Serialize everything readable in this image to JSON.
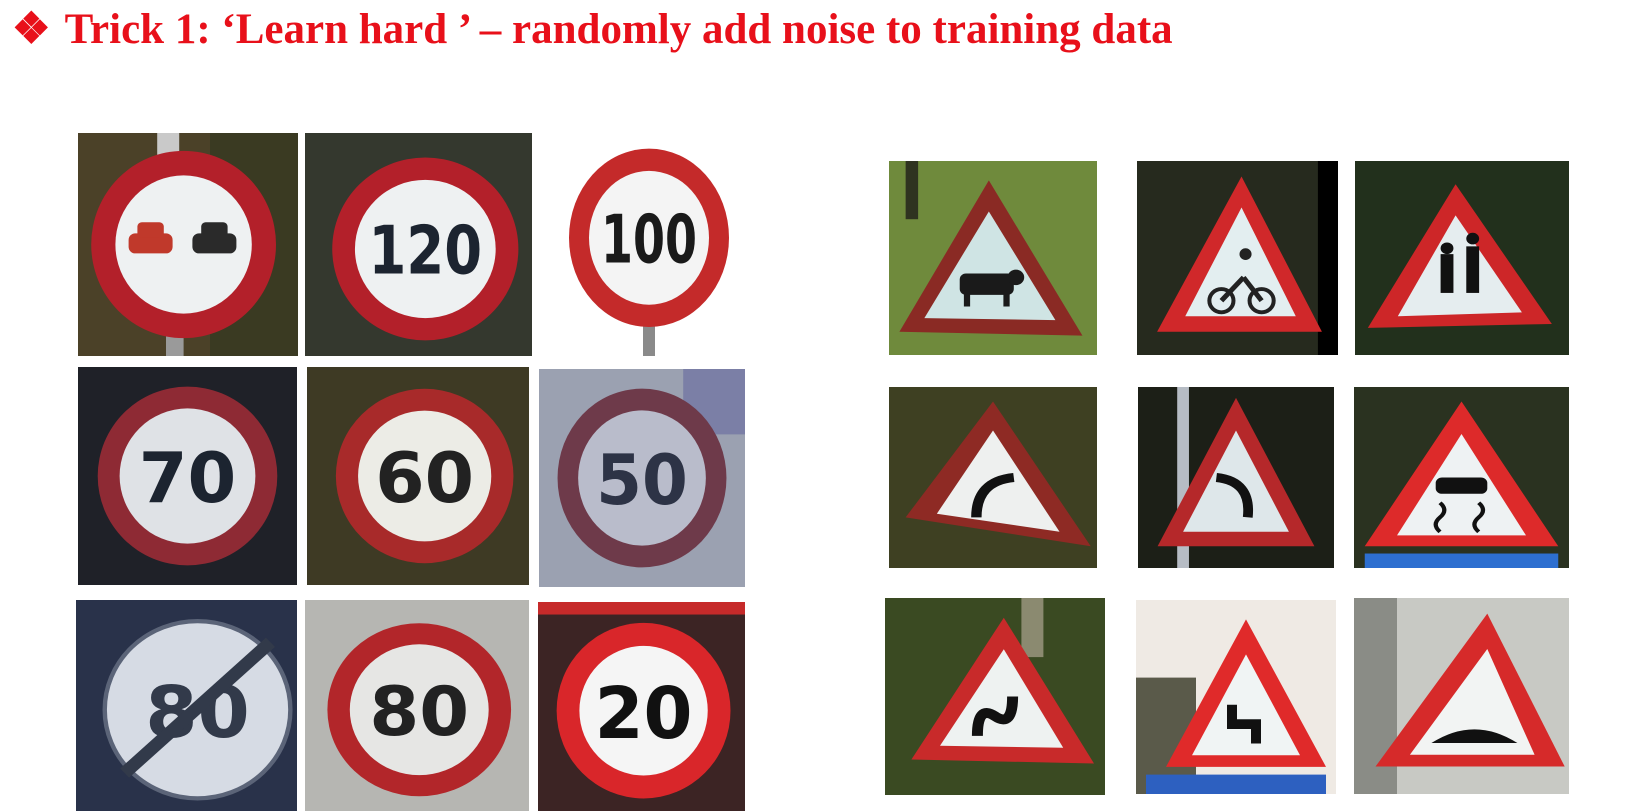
{
  "slide": {
    "bullet": "❖",
    "title": "Trick 1: ‘Learn hard ’ – randomly add noise to training data"
  },
  "prohibitory_signs": [
    {
      "icon": "no-overtaking-icon",
      "text": ""
    },
    {
      "icon": "speed-limit-icon",
      "text": "120"
    },
    {
      "icon": "speed-limit-icon",
      "text": "100"
    },
    {
      "icon": "speed-limit-icon",
      "text": "70"
    },
    {
      "icon": "speed-limit-icon",
      "text": "60"
    },
    {
      "icon": "speed-limit-icon",
      "text": "50"
    },
    {
      "icon": "end-speed-limit-icon",
      "text": "80"
    },
    {
      "icon": "speed-limit-icon",
      "text": "80"
    },
    {
      "icon": "speed-limit-icon",
      "text": "20"
    }
  ],
  "warning_signs": [
    {
      "icon": "cattle-crossing-icon"
    },
    {
      "icon": "cyclists-icon"
    },
    {
      "icon": "children-crossing-icon"
    },
    {
      "icon": "curve-left-icon"
    },
    {
      "icon": "curve-right-icon"
    },
    {
      "icon": "slippery-road-icon"
    },
    {
      "icon": "double-curve-icon"
    },
    {
      "icon": "winding-road-icon"
    },
    {
      "icon": "speed-bump-icon"
    }
  ],
  "colors": {
    "title": "#e8101a",
    "sign_red": "#b3202a",
    "sign_white": "#eef1f2"
  }
}
